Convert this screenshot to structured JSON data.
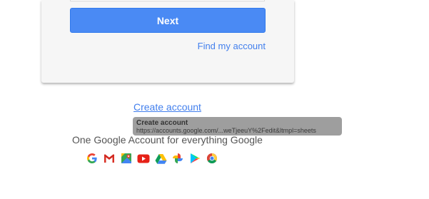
{
  "card": {
    "next_label": "Next",
    "find_account_label": "Find my account"
  },
  "footer": {
    "create_account_label": "Create account",
    "tagline": "One Google Account for everything Google",
    "apps": [
      {
        "icon": "google-icon"
      },
      {
        "icon": "gmail-icon"
      },
      {
        "icon": "maps-icon"
      },
      {
        "icon": "youtube-icon"
      },
      {
        "icon": "drive-icon"
      },
      {
        "icon": "photos-icon"
      },
      {
        "icon": "play-icon"
      },
      {
        "icon": "chrome-icon"
      }
    ]
  },
  "tooltip": {
    "title": "Create account",
    "url": "https://accounts.google.com/...weTjeeuY%2Fedit&ltmpl=sheets"
  },
  "colors": {
    "primary_button": "#4a8af4",
    "link": "#427fed",
    "card_bg": "#f6f6f6",
    "tooltip_bg": "#9e9e9e"
  }
}
